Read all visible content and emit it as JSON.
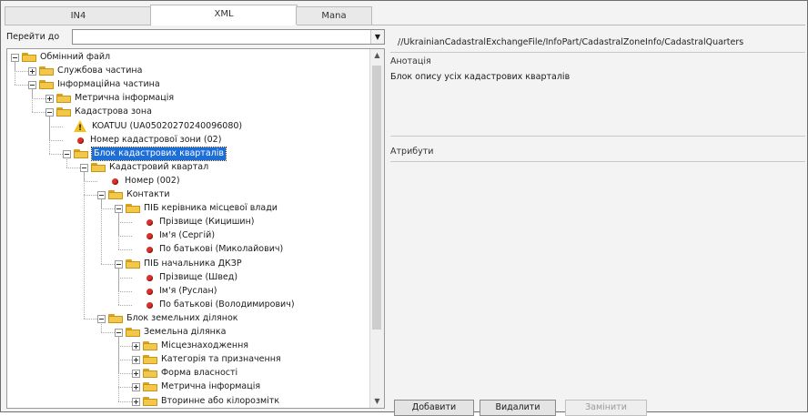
{
  "tabs": [
    "IN4",
    "XML",
    "Mana"
  ],
  "left": {
    "goto_label": "Перейти до",
    "goto_value": "",
    "tree": [
      {
        "label": "Обмінний файл",
        "kind": "folder",
        "state": "open"
      },
      {
        "label": "Службова частина",
        "kind": "folder",
        "state": "closed"
      },
      {
        "label": "Інформаційна частина",
        "kind": "folder",
        "state": "open"
      },
      {
        "label": "Метрична інформація",
        "kind": "folder",
        "state": "closed"
      },
      {
        "label": "Кадастрова зона",
        "kind": "folder",
        "state": "open"
      },
      {
        "label": "KOATUU (UA05020270240096080)",
        "kind": "warning"
      },
      {
        "label": "Номер кадастрової зони (02)",
        "kind": "leaf"
      },
      {
        "label": "Блок кадастрових кварталів",
        "kind": "folder",
        "state": "open",
        "selected": true
      },
      {
        "label": "Кадастровий квартал",
        "kind": "folder",
        "state": "open"
      },
      {
        "label": "Номер (002)",
        "kind": "leaf"
      },
      {
        "label": "Контакти",
        "kind": "folder",
        "state": "open"
      },
      {
        "label": "ПІБ керівника місцевої влади",
        "kind": "folder",
        "state": "open"
      },
      {
        "label": "Прізвище (Кицишин)",
        "kind": "leaf"
      },
      {
        "label": "Ім'я (Сергій)",
        "kind": "leaf"
      },
      {
        "label": "По батькові (Миколайович)",
        "kind": "leaf"
      },
      {
        "label": "ПІБ начальника ДКЗР",
        "kind": "folder",
        "state": "open"
      },
      {
        "label": "Прізвище (Швед)",
        "kind": "leaf"
      },
      {
        "label": "Ім'я (Руслан)",
        "kind": "leaf"
      },
      {
        "label": "По батькові (Володимирович)",
        "kind": "leaf"
      },
      {
        "label": "Блок земельних ділянок",
        "kind": "folder",
        "state": "open"
      },
      {
        "label": "Земельна ділянка",
        "kind": "folder",
        "state": "open"
      },
      {
        "label": "Місцезнаходження",
        "kind": "folder",
        "state": "closed"
      },
      {
        "label": "Категорія та призначення",
        "kind": "folder",
        "state": "closed"
      },
      {
        "label": "Форма власності",
        "kind": "folder",
        "state": "closed"
      },
      {
        "label": "Метрична інформація",
        "kind": "folder",
        "state": "closed"
      },
      {
        "label": "Вторинне або кілорозмітк",
        "kind": "folder",
        "state": "closed"
      }
    ]
  },
  "right": {
    "xpath": "//UkrainianCadastralExchangeFile/InfoPart/CadastralZoneInfo/CadastralQuarters",
    "annotation_title": "Анотація",
    "annotation_text": "Блок опису усіх кадастрових кварталів",
    "attributes_title": "Атрибути",
    "buttons": {
      "add": "Добавити",
      "delete": "Видалити",
      "replace": "Замінити"
    }
  },
  "colors": {
    "selection": "#1e6ed8",
    "folder": "#f2c74a",
    "leaf_dot": "#d9322a",
    "warning": "#f2c21b"
  }
}
